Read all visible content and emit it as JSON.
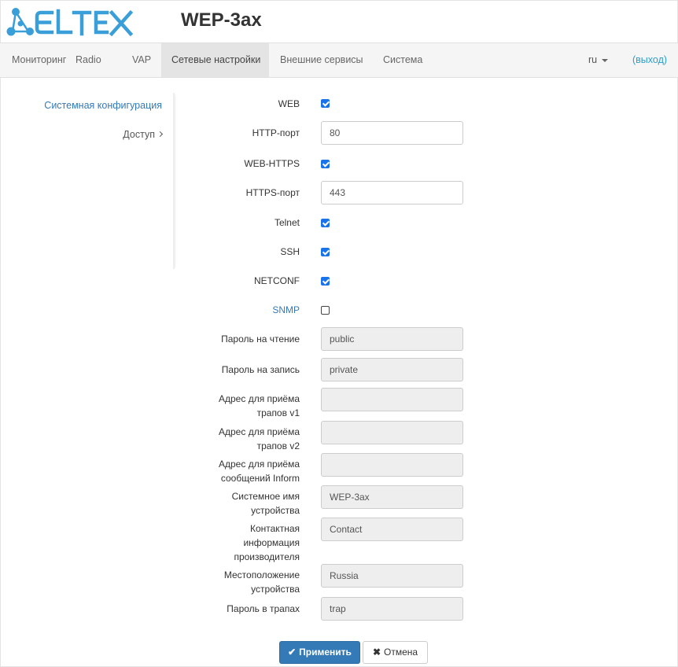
{
  "header": {
    "logo_text": "ELTEX",
    "device_title": "WEP-3ax"
  },
  "nav": {
    "items": [
      {
        "label": "Мониторинг",
        "active": false
      },
      {
        "label": "Radio",
        "active": false
      },
      {
        "label": "VAP",
        "active": false
      },
      {
        "label": "Сетевые настройки",
        "active": true
      },
      {
        "label": "Внешние сервисы",
        "active": false
      },
      {
        "label": "Система",
        "active": false
      }
    ],
    "language": "ru",
    "logout": "(выход)"
  },
  "sidemenu": {
    "items": [
      {
        "label": "Системная конфигурация",
        "active": true
      },
      {
        "label": "Доступ",
        "active": false
      }
    ]
  },
  "form": {
    "web": {
      "label": "WEB",
      "checked": true
    },
    "http_port": {
      "label": "HTTP-порт",
      "value": "80"
    },
    "web_https": {
      "label": "WEB-HTTPS",
      "checked": true
    },
    "https_port": {
      "label": "HTTPS-порт",
      "value": "443"
    },
    "telnet": {
      "label": "Telnet",
      "checked": true
    },
    "ssh": {
      "label": "SSH",
      "checked": true
    },
    "netconf": {
      "label": "NETCONF",
      "checked": true
    },
    "snmp": {
      "label": "SNMP",
      "checked": false
    },
    "read_password": {
      "label": "Пароль на чтение",
      "value": "public"
    },
    "write_password": {
      "label": "Пароль на запись",
      "value": "private"
    },
    "traps_v1": {
      "label_line1": "Адрес для приёма",
      "label_line2": "трапов v1",
      "value": ""
    },
    "traps_v2": {
      "label_line1": "Адрес для приёма",
      "label_line2": "трапов v2",
      "value": ""
    },
    "inform": {
      "label_line1": "Адрес для приёма",
      "label_line2": "сообщений Inform",
      "value": ""
    },
    "sys_name": {
      "label_line1": "Системное имя",
      "label_line2": "устройства",
      "value": "WEP-3ax"
    },
    "contact": {
      "label_line1": "Контактная",
      "label_line2": "информация",
      "label_line3": "производителя",
      "value": "Contact"
    },
    "location": {
      "label_line1": "Местоположение",
      "label_line2": "устройства",
      "value": "Russia"
    },
    "trap_password": {
      "label": "Пароль в трапах",
      "value": "trap"
    }
  },
  "buttons": {
    "apply": "Применить",
    "cancel": "Отмена"
  },
  "colors": {
    "brand": "#3a9fd8",
    "primary": "#337ab7",
    "link": "#2a9fc8",
    "checkbox": "#1a73e8"
  }
}
